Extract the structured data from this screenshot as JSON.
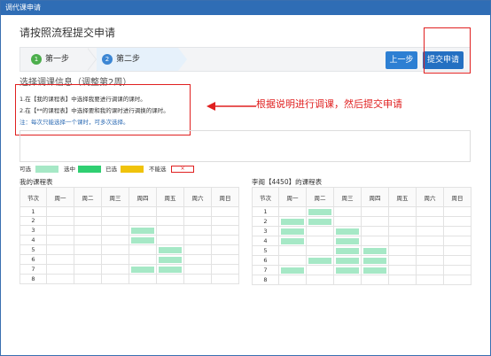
{
  "dialog": {
    "title": "调代课申请"
  },
  "heading": "请按照流程提交申请",
  "steps": [
    {
      "num": "1",
      "label": "第一步"
    },
    {
      "num": "2",
      "label": "第二步"
    }
  ],
  "buttons": {
    "prev": "上一步",
    "submit": "提交申请"
  },
  "section_title": "选择调课信息（调整第2周）",
  "instructions": {
    "line1": "1.在【我的课程表】中选择我要进行调课的课时。",
    "line2": "2.在【**的课程表】中选择要和我的课时进行调换的课时。",
    "note": "注：每次只能选择一个课时，可多次选择。"
  },
  "annotation": "根据说明进行调课，然后提交申请",
  "legend": {
    "available": "可选",
    "selected": "选中",
    "chosen": "已选",
    "unavailable": "不能选",
    "unavailable_mark": "×"
  },
  "colors": {
    "available": "#a6e8c6",
    "selected": "#2fcf71",
    "chosen": "#f0c30b",
    "primary": "#2d7fd3",
    "annotation": "#e02020"
  },
  "tables": {
    "headers": [
      "节次",
      "周一",
      "周二",
      "周三",
      "周四",
      "周五",
      "周六",
      "周日"
    ],
    "my": {
      "title": "我的课程表",
      "rows": [
        "1",
        "2",
        "3",
        "4",
        "5",
        "6",
        "7",
        "8"
      ],
      "filled": [
        [],
        [],
        [
          3
        ],
        [
          3
        ],
        [
          4
        ],
        [
          4
        ],
        [
          3,
          4
        ],
        []
      ]
    },
    "other": {
      "title": "李阁【4450】的课程表",
      "rows": [
        "1",
        "2",
        "3",
        "4",
        "5",
        "6",
        "7",
        "8"
      ],
      "filled": [
        [
          1
        ],
        [
          0,
          1
        ],
        [
          0,
          2
        ],
        [
          0,
          2
        ],
        [
          2,
          3
        ],
        [
          1,
          2,
          3
        ],
        [
          0,
          2,
          3
        ],
        []
      ]
    }
  }
}
